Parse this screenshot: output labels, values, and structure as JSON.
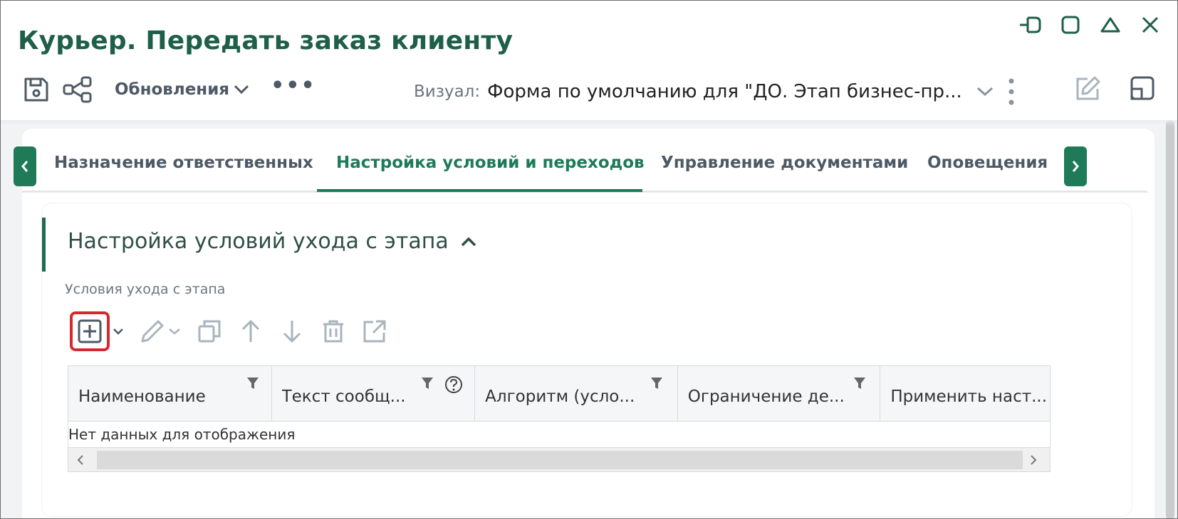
{
  "window": {
    "title": "Курьер. Передать заказ клиенту"
  },
  "toolbar": {
    "updates_label": "Обновления",
    "more_label": "•••",
    "visual_label": "Визуал:",
    "visual_value": "Форма по умолчанию для \"ДО. Этап бизнес-пр..."
  },
  "tabs": [
    {
      "label": "Назначение ответственных",
      "active": false
    },
    {
      "label": "Настройка условий и переходов",
      "active": true
    },
    {
      "label": "Управление документами",
      "active": false
    },
    {
      "label": "Оповещения",
      "active": false
    }
  ],
  "section": {
    "title": "Настройка условий ухода с этапа",
    "field_label": "Условия ухода с этапа"
  },
  "grid": {
    "columns": [
      "Наименование",
      "Текст сообщ...",
      "Алгоритм (усло...",
      "Ограничение де...",
      "Применить наст..."
    ],
    "empty_text": "Нет данных для отображения"
  },
  "colors": {
    "brand": "#1f7a58",
    "title": "#1f5f49",
    "highlight": "#d7282f",
    "icon": "#4d5a66",
    "icon_muted": "#a9b4bd"
  }
}
